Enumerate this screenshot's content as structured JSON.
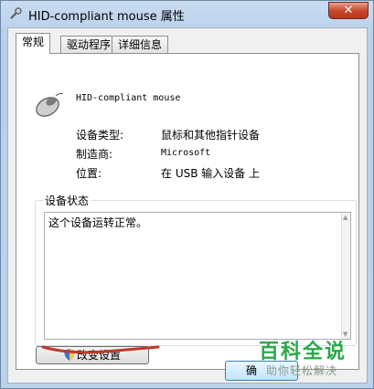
{
  "window": {
    "title": "HID-compliant mouse 属性",
    "close_label": "✕"
  },
  "tabs": [
    {
      "label": "常规",
      "active": true
    },
    {
      "label": "驱动程序",
      "active": false
    },
    {
      "label": "详细信息",
      "active": false
    }
  ],
  "device": {
    "name": "HID-compliant mouse",
    "properties": [
      {
        "label": "设备类型:",
        "value": "鼠标和其他指针设备"
      },
      {
        "label": "制造商:",
        "value": "Microsoft"
      },
      {
        "label": "位置:",
        "value": "在 USB 输入设备 上"
      }
    ]
  },
  "status": {
    "group_title": "设备状态",
    "text": "这个设备运转正常。"
  },
  "buttons": {
    "change_settings": "改变设置",
    "ok": "确"
  },
  "watermark": {
    "logo": "百科全说",
    "sub": "助你轻松解决"
  },
  "colors": {
    "annotation": "#c0392b",
    "watermark": "#2aa84a"
  }
}
